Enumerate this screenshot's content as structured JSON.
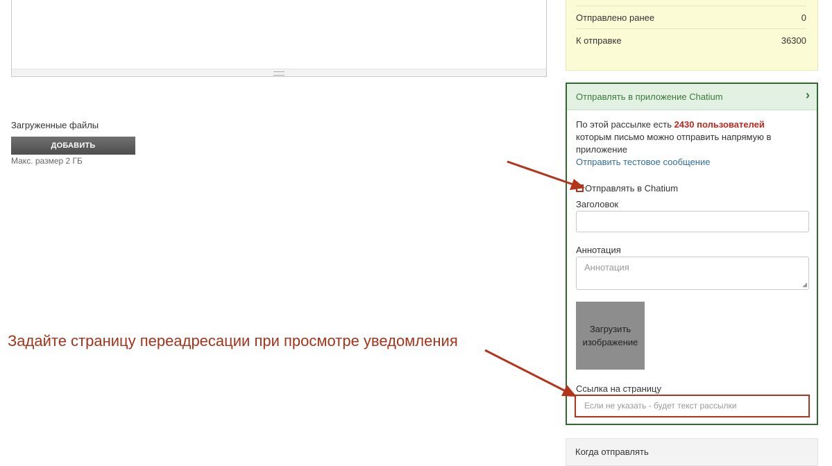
{
  "stats": {
    "sent_before_label": "Отправлено ранее",
    "sent_before_value": "0",
    "to_send_label": "К отправке",
    "to_send_value": "36300"
  },
  "files": {
    "label": "Загруженные файлы",
    "add_button": "ДОБАВИТЬ",
    "max_size": "Макс. размер 2 ГБ"
  },
  "chatium": {
    "header": "Отправлять в приложение Chatium",
    "info_prefix": "По этой рассылке есть ",
    "info_count": "2430 пользователей",
    "info_suffix": " которым письмо можно отправить напрямую в приложение",
    "test_link": "Отправить тестовое сообщение",
    "send_checkbox_label": "Отправлять в Chatium",
    "title_label": "Заголовок",
    "title_value": "",
    "annotation_label": "Аннотация",
    "annotation_placeholder": "Аннотация",
    "upload_button": "Загрузить изображение",
    "link_label": "Ссылка на страницу",
    "link_placeholder": "Если не указать - будет текст рассылки"
  },
  "when": {
    "title": "Когда отправлять"
  },
  "annotation": {
    "instruction": "Задайте страницу переадресации при просмотре уведомления"
  },
  "colors": {
    "accent_green": "#2e6b2e",
    "highlight_red": "#b3331b",
    "stats_bg": "#fbfbd6"
  }
}
